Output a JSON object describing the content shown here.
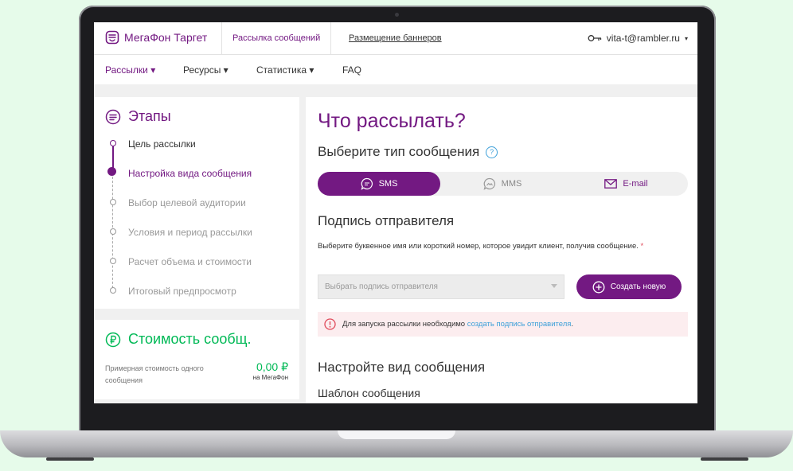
{
  "header": {
    "brand": "МегаФон Таргет",
    "tab_messages": "Рассылка сообщений",
    "tab_banners": "Размещение баннеров",
    "account": "vita-t@rambler.ru"
  },
  "menu": [
    {
      "label": "Рассылки ▾"
    },
    {
      "label": "Ресурсы ▾"
    },
    {
      "label": "Статистика ▾"
    },
    {
      "label": "FAQ"
    }
  ],
  "stages": {
    "title": "Этапы",
    "steps": [
      {
        "label": "Цель рассылки",
        "state": "done"
      },
      {
        "label": "Настройка вида сообщения",
        "state": "active"
      },
      {
        "label": "Выбор целевой аудитории",
        "state": "pending"
      },
      {
        "label": "Условия и период рассылки",
        "state": "pending"
      },
      {
        "label": "Расчет объема и стоимости",
        "state": "pending"
      },
      {
        "label": "Итоговый предпросмотр",
        "state": "pending"
      }
    ]
  },
  "cost": {
    "title": "Стоимость сообщ.",
    "description": "Примерная стоимость одного сообщения",
    "value": "0,00 ₽",
    "operator": "на МегаФон"
  },
  "main": {
    "title": "Что рассылать?",
    "type_heading": "Выберите тип сообщения",
    "types": [
      {
        "label": "SMS",
        "selected": true
      },
      {
        "label": "MMS",
        "selected": false
      },
      {
        "label": "E-mail",
        "selected": false
      }
    ],
    "sender_heading": "Подпись отправителя",
    "sender_hint": "Выберите буквенное имя или короткий номер, которое увидит клиент, получив сообщение.",
    "required_mark": "*",
    "sender_select_placeholder": "Выбрать подпись отправителя",
    "create_button": "Создать новую",
    "alert_text": "Для запуска рассылки необходимо ",
    "alert_link": "создать подпись отправителя",
    "alert_end": ".",
    "view_heading": "Настройте вид сообщения",
    "template_heading": "Шаблон сообщения"
  },
  "colors": {
    "brand_purple": "#731982",
    "brand_green": "#00b956",
    "link_blue": "#3ea0d9",
    "alert_bg": "#fcedef"
  }
}
